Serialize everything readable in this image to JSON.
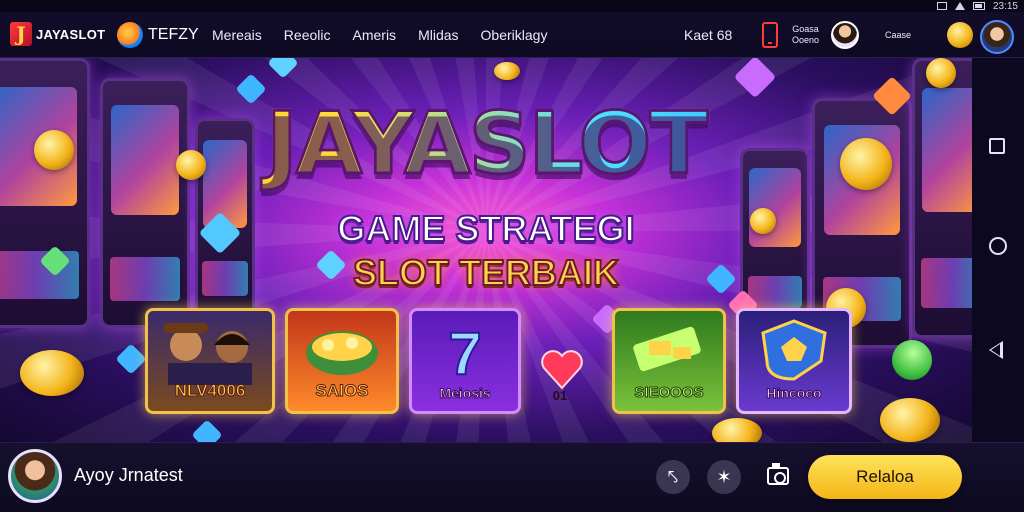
{
  "status_bar": {
    "time": "23:15",
    "icons": [
      "square-icon",
      "alert-triangle-icon",
      "battery-icon"
    ]
  },
  "header": {
    "logo_mark": "J",
    "logo_text": "JAYASLOT",
    "brand2_text": "TEFZY",
    "nav": [
      "Mereais",
      "Reeolic",
      "Ameris",
      "Mlidas",
      "Oberiklagy"
    ],
    "stake_label": "Kaet 68",
    "mini_labels": [
      "Goasa",
      "Ooeno",
      "Caase"
    ],
    "accent_color": "#ffd33a"
  },
  "hero": {
    "title": "JAYASLOT",
    "subtitle_line1": "GAME STRATEGI",
    "subtitle_line2": "SLOT TERBAIK",
    "cards": [
      {
        "label": "NLV4006",
        "kind": "players"
      },
      {
        "label": "SAIOS",
        "kind": "treasure"
      },
      {
        "label": "Meiosis",
        "kind": "seven",
        "symbol": "7"
      },
      {
        "label": "SIEOOOS",
        "kind": "cash"
      },
      {
        "label": "Hincoco",
        "kind": "shield"
      }
    ],
    "heart_label": "01"
  },
  "android_nav": {
    "buttons": [
      "recent-apps",
      "home",
      "back"
    ]
  },
  "bottom_bar": {
    "user_name": "Ayoy Jrnatest",
    "action_buttons": [
      "refresh-icon",
      "tools-icon",
      "camera-icon"
    ],
    "action_glyphs": [
      "⤣",
      "✶"
    ],
    "cta_label": "Relaloa",
    "cta_color": "#f4b516"
  }
}
